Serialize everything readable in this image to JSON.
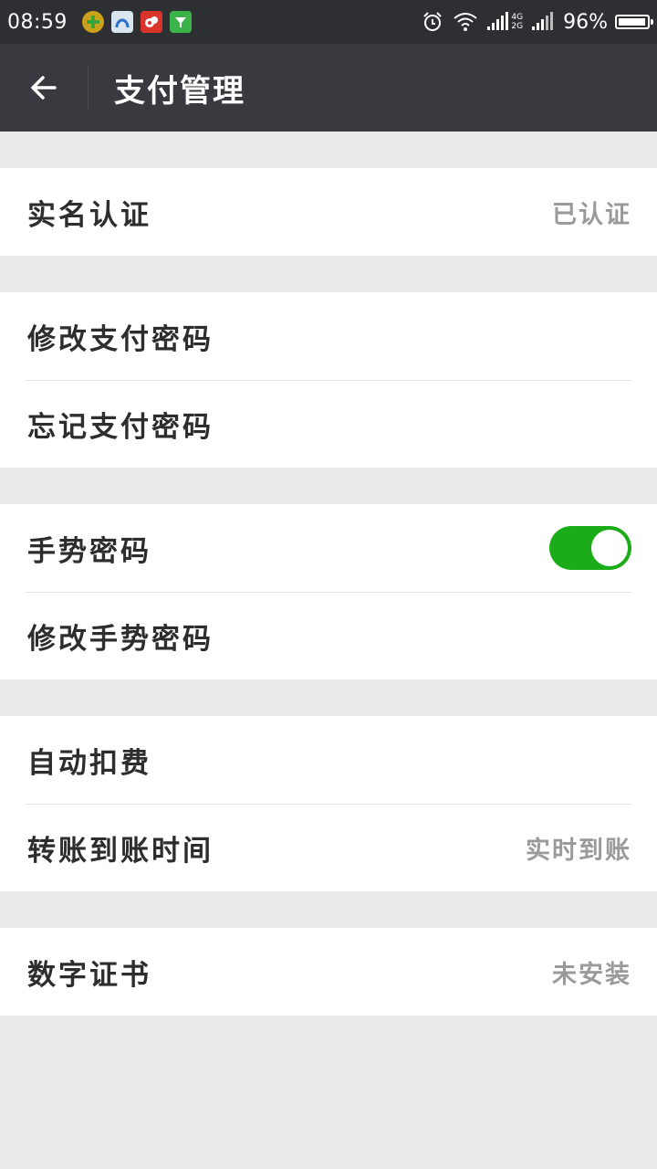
{
  "status_bar": {
    "time": "08:59",
    "notification_icons": [
      "game-app-icon",
      "browser-app-icon",
      "weibo-app-icon",
      "green-app-icon"
    ],
    "network_labels": [
      "4G",
      "2G"
    ],
    "battery_percent": "96%",
    "battery_level": 0.96
  },
  "app_bar": {
    "title": "支付管理"
  },
  "groups": [
    [
      {
        "label": "实名认证",
        "value": "已认证"
      }
    ],
    [
      {
        "label": "修改支付密码",
        "value": ""
      },
      {
        "label": "忘记支付密码",
        "value": ""
      }
    ],
    [
      {
        "label": "手势密码",
        "toggle_on": true
      },
      {
        "label": "修改手势密码",
        "value": ""
      }
    ],
    [
      {
        "label": "自动扣费",
        "value": ""
      },
      {
        "label": "转账到账时间",
        "value": "实时到账"
      }
    ],
    [
      {
        "label": "数字证书",
        "value": "未安装"
      }
    ]
  ],
  "colors": {
    "toggle_on": "#1aad19",
    "app_bar": "#393a3f",
    "status_bar": "#2e2f33",
    "background": "#ebebeb"
  }
}
